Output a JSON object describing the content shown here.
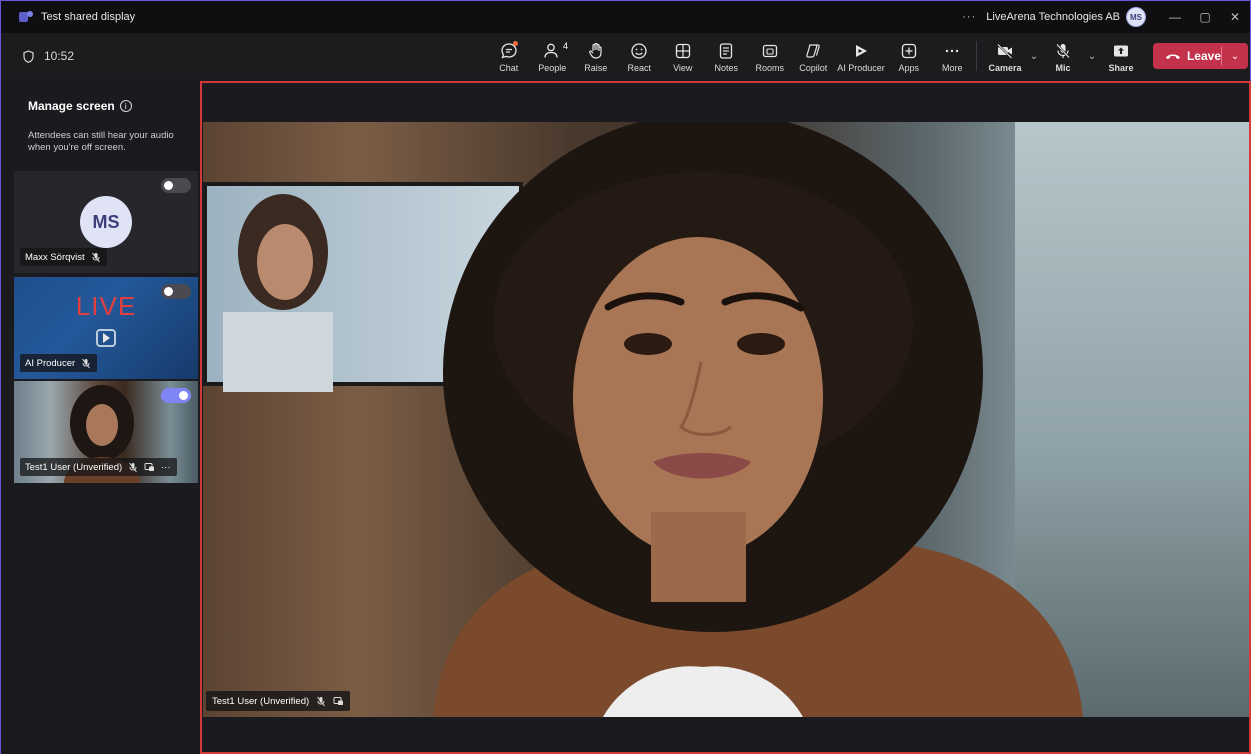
{
  "window": {
    "title": "Test shared display",
    "more_label": "···",
    "org_name": "LiveArena Technologies AB",
    "user_initials": "MS",
    "minimize": "—",
    "restore": "▢",
    "close": "✕"
  },
  "toolbar": {
    "timer": "10:52",
    "items": [
      {
        "label": "Chat",
        "icon": "chat-icon"
      },
      {
        "label": "People",
        "icon": "people-icon",
        "badge": "4"
      },
      {
        "label": "Raise",
        "icon": "raise-hand-icon"
      },
      {
        "label": "React",
        "icon": "react-icon"
      },
      {
        "label": "View",
        "icon": "view-icon"
      },
      {
        "label": "Notes",
        "icon": "notes-icon"
      },
      {
        "label": "Rooms",
        "icon": "rooms-icon"
      },
      {
        "label": "Copilot",
        "icon": "copilot-icon"
      },
      {
        "label": "AI Producer",
        "icon": "ai-producer-icon"
      },
      {
        "label": "Apps",
        "icon": "apps-icon"
      },
      {
        "label": "More",
        "icon": "more-icon"
      }
    ],
    "camera": {
      "label": "Camera",
      "icon": "camera-off-icon"
    },
    "mic": {
      "label": "Mic",
      "icon": "mic-off-icon"
    },
    "share": {
      "label": "Share",
      "icon": "share-icon"
    },
    "leave": {
      "label": "Leave",
      "color": "#c4314b"
    },
    "chevron": "⌄"
  },
  "sidebar": {
    "title": "Manage screen",
    "info": "i",
    "description": "Attendees can still hear your audio when you're off screen.",
    "tiles": [
      {
        "name": "Maxx Sörqvist",
        "initials": "MS",
        "toggle_on": false
      },
      {
        "name": "AI Producer",
        "overlay_text": "LIVE",
        "toggle_on": false
      },
      {
        "name": "Test1 User (Unverified)",
        "toggle_on": true,
        "more": "···"
      }
    ]
  },
  "stage": {
    "name": "Test1 User (Unverified)",
    "border_color": "#d23a3a"
  }
}
